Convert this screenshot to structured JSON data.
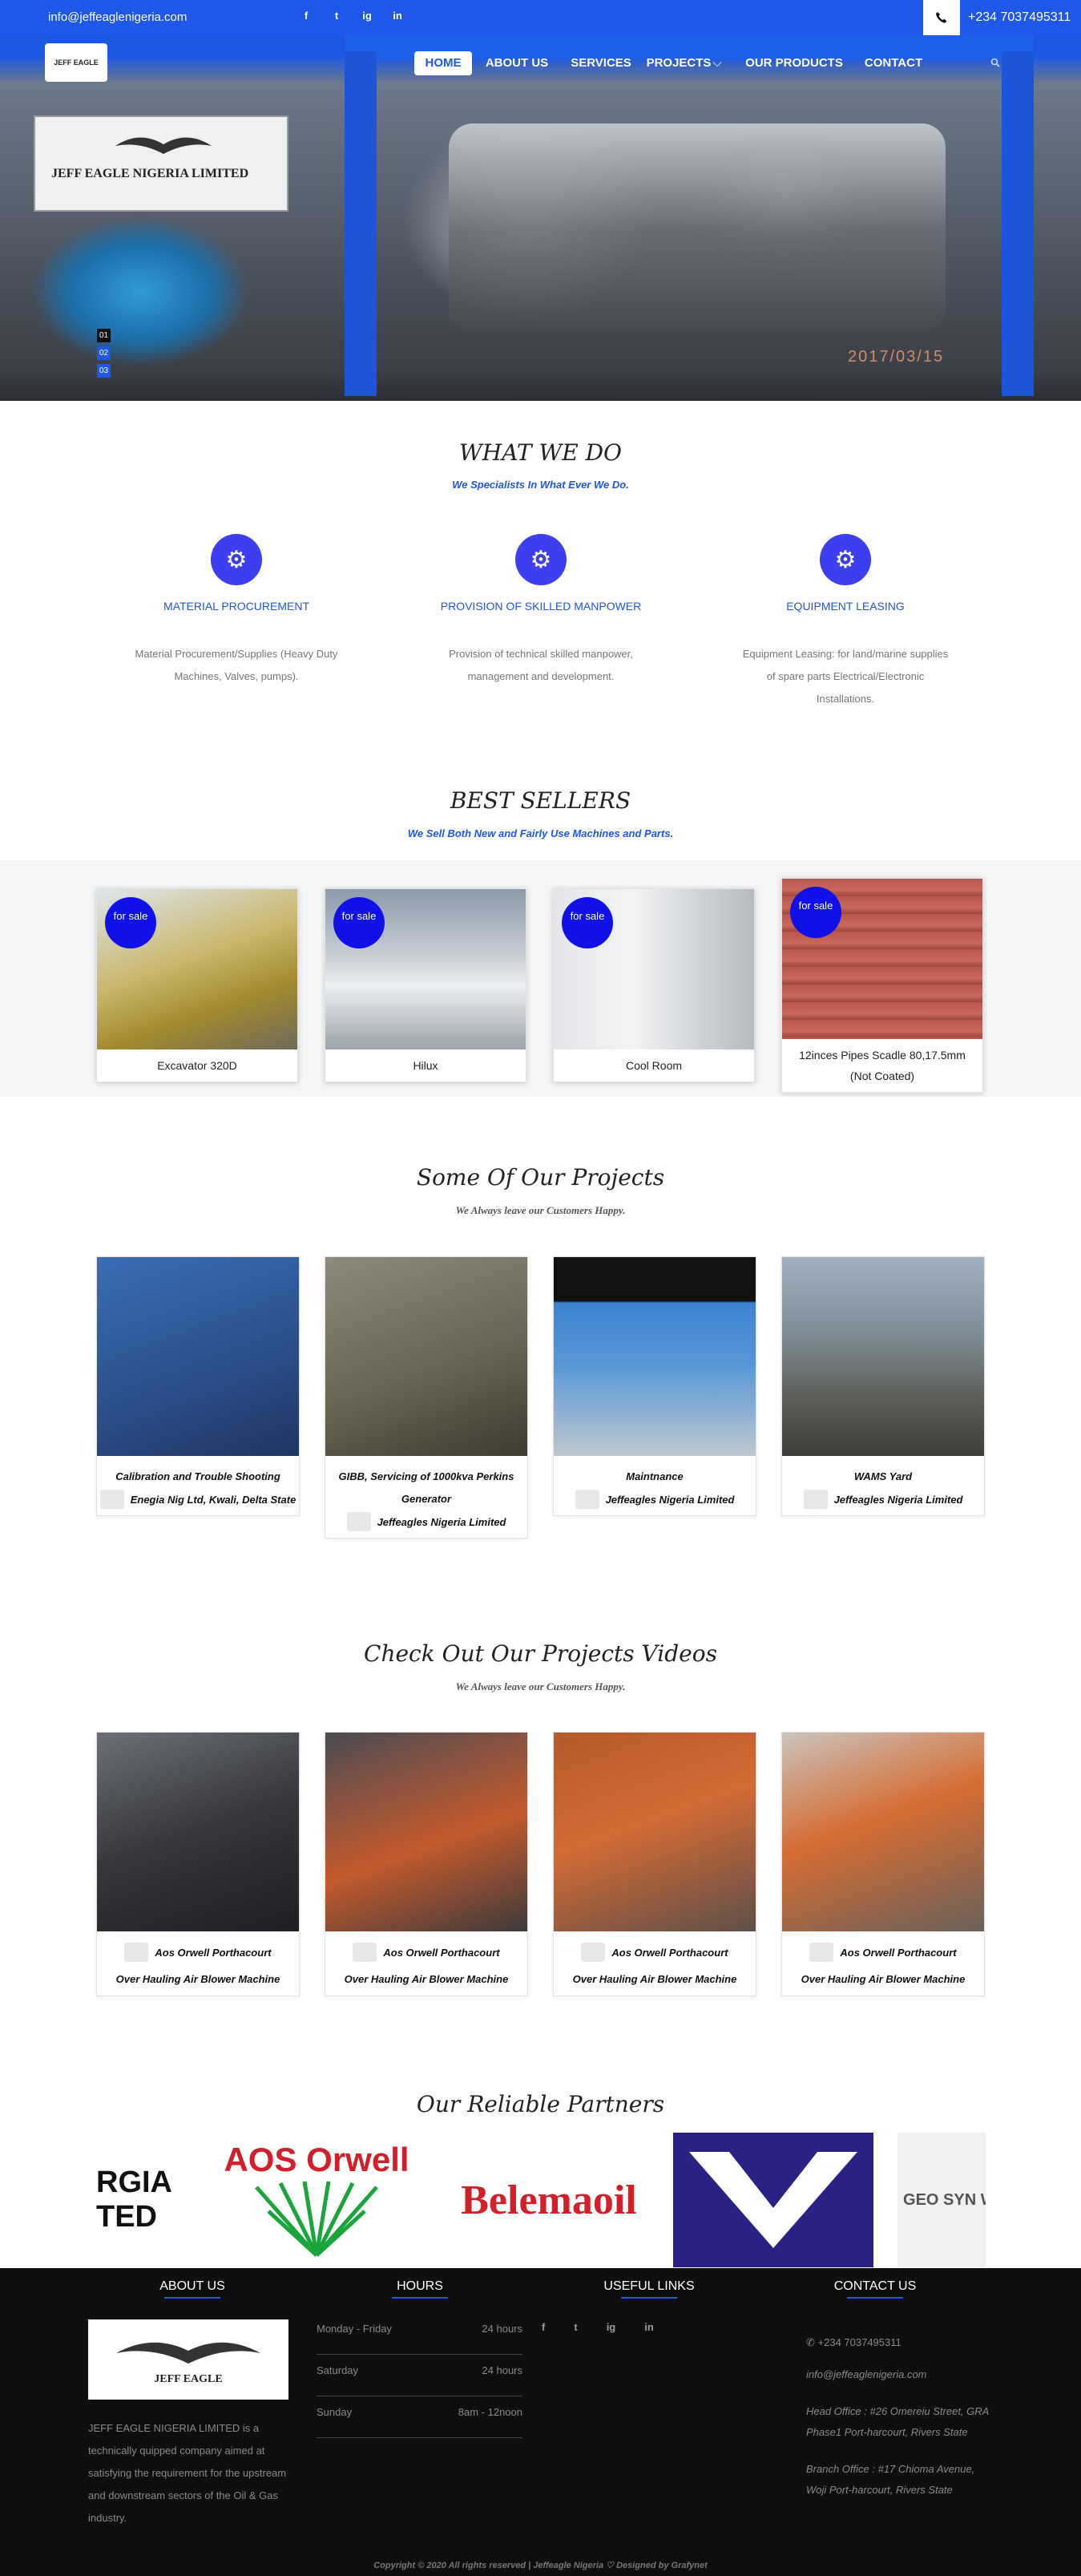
{
  "topbar": {
    "email": "info@jeffeaglenigeria.com",
    "social": [
      "f",
      "t",
      "ig",
      "in"
    ],
    "phone_icon": "phone-icon",
    "phone": "+234 7037495311"
  },
  "nav": {
    "logo_text": "JEFF EAGLE",
    "items": [
      "HOME",
      "ABOUT US",
      "SERVICES",
      "PROJECTS",
      "OUR PRODUCTS",
      "CONTACT"
    ],
    "projects_caret": "⌵",
    "search_icon": "search-icon"
  },
  "hero": {
    "sign_text": "JEFF EAGLE NIGERIA LIMITED",
    "stamp": "2017/03/15",
    "slides": [
      "01",
      "02",
      "03"
    ],
    "active_slide": 1
  },
  "what_we_do": {
    "title": "WHAT WE DO",
    "subtitle": "We Specialists In What Ever We Do.",
    "features": [
      {
        "icon": "gears-icon",
        "title": "MATERIAL PROCUREMENT",
        "desc": "Material Procurement/Supplies (Heavy Duty Machines, Valves, pumps)."
      },
      {
        "icon": "gears-icon",
        "title": "PROVISION OF SKILLED MANPOWER",
        "desc": "Provision of technical skilled manpower, management and development."
      },
      {
        "icon": "gears-icon",
        "title": "EQUIPMENT LEASING",
        "desc": "Equipment Leasing: for land/marine supplies of spare parts Electrical/Electronic Installations."
      }
    ]
  },
  "best_sellers": {
    "title": "BEST SELLERS",
    "subtitle": "We Sell Both New and Fairly Use Machines and Parts.",
    "badge": "for sale",
    "products": [
      {
        "name": "Excavator 320D",
        "color": "#b89a3a"
      },
      {
        "name": "Hilux",
        "color": "#8d98a4"
      },
      {
        "name": "Cool Room",
        "color": "#c9ccd1"
      },
      {
        "name": "12inces Pipes Scadle 80,17.5mm (Not Coated)",
        "color": "#b0584a"
      }
    ]
  },
  "projects": {
    "title": "Some Of Our Projects",
    "subtitle": "We Always leave our Customers Happy.",
    "items": [
      {
        "title": "Calibration and Trouble Shooting",
        "client": "Enegia Nig Ltd, Kwali, Delta State",
        "color": "#2f5fa8"
      },
      {
        "title": "GIBB, Servicing of 1000kva Perkins Generator",
        "client": "Jeffeagles Nigeria Limited",
        "color": "#6f6a55"
      },
      {
        "title": "Maintnance",
        "client": "Jeffeagles Nigeria Limited",
        "color": "#4f89c8"
      },
      {
        "title": "WAMS Yard",
        "client": "Jeffeagles Nigeria Limited",
        "color": "#5f6a6f"
      }
    ]
  },
  "videos": {
    "title": "Check Out Our Projects Videos",
    "subtitle": "We Always leave our Customers Happy.",
    "items": [
      {
        "client": "Aos Orwell Porthacourt",
        "title": "Over Hauling Air Blower Machine",
        "color": "#3a3d44"
      },
      {
        "client": "Aos Orwell Porthacourt",
        "title": "Over Hauling Air Blower Machine",
        "color": "#7a4a3a"
      },
      {
        "client": "Aos Orwell Porthacourt",
        "title": "Over Hauling Air Blower Machine",
        "color": "#8a5a40"
      },
      {
        "client": "Aos Orwell Porthacourt",
        "title": "Over Hauling Air Blower Machine",
        "color": "#8b7a6a"
      }
    ]
  },
  "partners": {
    "title": "Our Reliable Partners",
    "logos": [
      "RGIA TED",
      "AOS Orwell",
      "Belemaoil",
      "V",
      "GEO SYN WEST AF"
    ]
  },
  "footer": {
    "about_title": "ABOUT US",
    "logo_text": "JEFF EAGLE",
    "about_text": "JEFF EAGLE NIGERIA LIMITED is a technically quipped company aimed at satisfying the requirement for the upstream and downstream sectors of the Oil & Gas industry.",
    "hours_title": "HOURS",
    "hours": [
      {
        "day": "Monday - Friday",
        "time": "24 hours"
      },
      {
        "day": "Saturday",
        "time": "24 hours"
      },
      {
        "day": "Sunday",
        "time": "8am - 12noon"
      }
    ],
    "links_title": "USEFUL LINKS",
    "social": [
      "f",
      "t",
      "ig",
      "in"
    ],
    "contact_title": "CONTACT US",
    "phone": "+234 7037495311",
    "email": "info@jeffeaglenigeria.com",
    "head_office": "Head Office : #26 Omereiu Street, GRA Phase1 Port-harcourt, Rivers State",
    "branch_office": "Branch Office : #17 Chioma Avenue, Woji Port-harcourt, Rivers State",
    "copyright": "Copyright © 2020 All rights reserved | Jeffeagle Nigeria ♡ Designed by Grafynet"
  }
}
